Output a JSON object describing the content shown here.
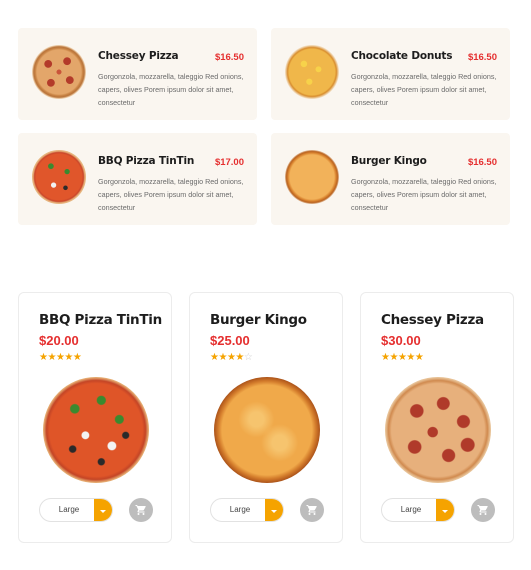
{
  "menu_items": [
    {
      "name": "Chessey Pizza",
      "price": "$16.50",
      "description": "Gorgonzola, mozzarella, taleggio Red onions, capers, olives Porem ipsum dolor sit amet, consectetur",
      "icon": "pepperoni-pizza-image"
    },
    {
      "name": "Chocolate Donuts",
      "price": "$16.50",
      "description": "Gorgonzola, mozzarella, taleggio Red onions, capers, olives Porem ipsum dolor sit amet, consectetur",
      "icon": "corn-pizza-image"
    },
    {
      "name": "BBQ Pizza TinTin",
      "price": "$17.00",
      "description": "Gorgonzola, mozzarella, taleggio Red onions, capers, olives Porem ipsum dolor sit amet, consectetur",
      "icon": "veggie-pizza-image"
    },
    {
      "name": "Burger Kingo",
      "price": "$16.50",
      "description": "Gorgonzola, mozzarella, taleggio Red onions, capers, olives Porem ipsum dolor sit amet, consectetur",
      "icon": "cheese-pizza-image"
    }
  ],
  "products": [
    {
      "name": "BBQ Pizza TinTin",
      "price": "$20.00",
      "rating": 5,
      "max_rating": 5,
      "size": "Large",
      "icon": "veggie-pizza-image"
    },
    {
      "name": "Burger Kingo",
      "price": "$25.00",
      "rating": 4,
      "max_rating": 5,
      "size": "Large",
      "icon": "cheese-pizza-image"
    },
    {
      "name": "Chessey Pizza",
      "price": "$30.00",
      "rating": 5,
      "max_rating": 5,
      "size": "Large",
      "icon": "pepperoni-pizza-image"
    }
  ],
  "colors": {
    "accent": "#f5a300",
    "price": "#e52f2f",
    "card_bg": "#faf6f0",
    "cart_button": "#bdbdbd"
  }
}
